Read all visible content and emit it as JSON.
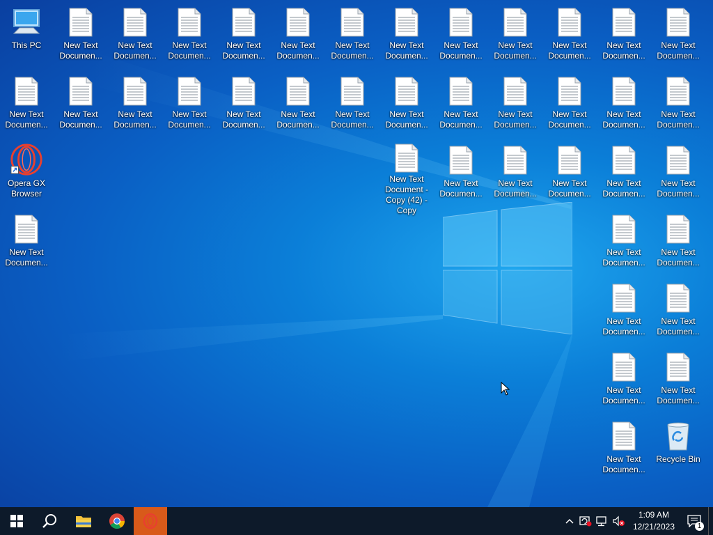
{
  "desktop": {
    "icons": {
      "this_pc": "This PC",
      "opera": "Opera GX Browser",
      "recycle_bin": "Recycle Bin",
      "doc": "New Text Documen...",
      "doc_copy42": "New Text Document - Copy (42) - Copy"
    }
  },
  "taskbar": {
    "start": "start-icon",
    "search": "search-icon",
    "explorer": "folder-icon",
    "chrome": "chrome-icon",
    "opera": "opera-icon"
  },
  "tray": {
    "time": "1:09 AM",
    "date": "12/21/2023",
    "notifications_count": "1"
  },
  "colors": {
    "taskbar": "#0d1a2a",
    "active_app": "#d85a1a",
    "wallpaper": "#0b7fd8"
  }
}
